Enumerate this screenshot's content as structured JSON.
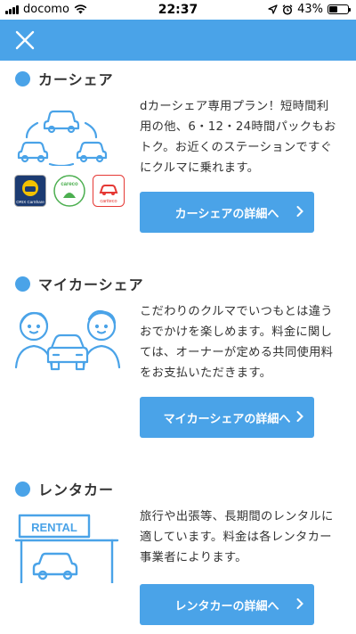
{
  "status_bar": {
    "carrier": "docomo",
    "time": "22:37",
    "battery": "43%",
    "battery_level": 0.43,
    "icons": [
      "signal-icon",
      "wifi-icon",
      "location-icon",
      "alarm-icon",
      "battery-icon"
    ]
  },
  "header": {
    "close_icon": "close-icon",
    "bg": "#4aa3e8"
  },
  "sections": [
    {
      "title": "カーシェア",
      "description": "dカーシェア専用プラン！短時間利用の他、6・12・24時間パックもおトク。お近くのステーションですぐにクルマに乗れます。",
      "button": "カーシェアの詳細へ",
      "logos": [
        {
          "name": "orix-carshare-logo",
          "text": "ORIX CarShare"
        },
        {
          "name": "careco-logo",
          "text": "careco"
        },
        {
          "name": "cariteco-logo",
          "text": "cariteco"
        }
      ]
    },
    {
      "title": "マイカーシェア",
      "description": "こだわりのクルマでいつもとは違うおでかけを楽しめます。料金に関しては、オーナーが定める共同使用料をお支払いただきます。",
      "button": "マイカーシェアの詳細へ"
    },
    {
      "title": "レンタカー",
      "description": "旅行や出張等、長期間のレンタルに適しています。料金は各レンタカー事業者によります。",
      "button": "レンタカーの詳細へ",
      "sign_text": "RENTAL"
    }
  ],
  "colors": {
    "accent": "#4aa3e8",
    "text": "#333333"
  }
}
